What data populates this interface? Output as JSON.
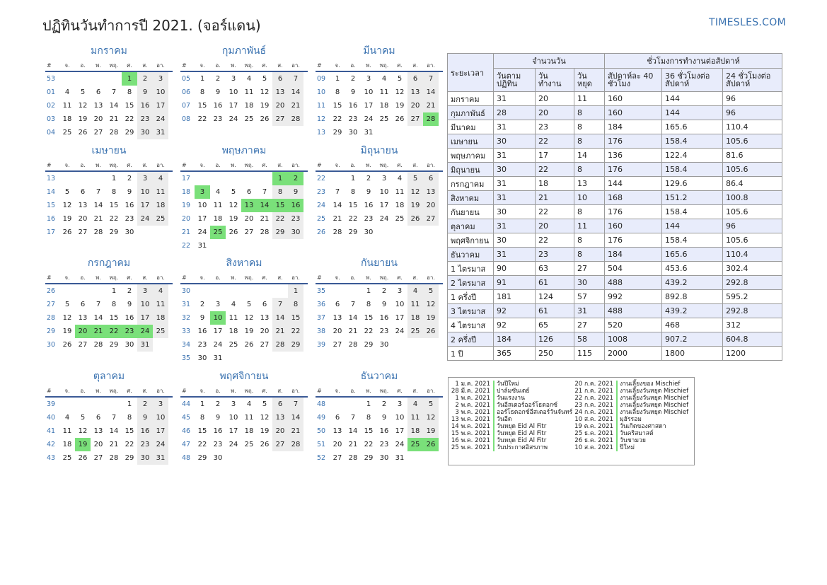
{
  "title": "ปฏิทินวันทำการปี 2021. (จอร์แดน)",
  "site": "TIMESLES.COM",
  "colors": {
    "accent": "#3a72b0",
    "holiday": "#7ae07a",
    "weekend": "#ececec",
    "table_header": "#e8ecfb"
  },
  "weekday_headers": [
    "#",
    "จ.",
    "อ.",
    "พ.",
    "พฤ.",
    "ศ.",
    "ส.",
    "อา."
  ],
  "months": [
    {
      "name": "มกราคม",
      "first": 4,
      "days": 31,
      "weeks": [
        "53",
        "01",
        "02",
        "03",
        "04"
      ],
      "holidays": [
        1
      ]
    },
    {
      "name": "กุมภาพันธ์",
      "first": 0,
      "days": 28,
      "weeks": [
        "05",
        "06",
        "07",
        "08"
      ],
      "holidays": []
    },
    {
      "name": "มีนาคม",
      "first": 0,
      "days": 31,
      "weeks": [
        "09",
        "10",
        "11",
        "12",
        "13"
      ],
      "holidays": [
        28
      ]
    },
    {
      "name": "เมษายน",
      "first": 3,
      "days": 30,
      "weeks": [
        "13",
        "14",
        "15",
        "16",
        "17"
      ],
      "holidays": []
    },
    {
      "name": "พฤษภาคม",
      "first": 5,
      "days": 31,
      "weeks": [
        "17",
        "18",
        "19",
        "20",
        "21",
        "22"
      ],
      "holidays": [
        1,
        2,
        3,
        13,
        14,
        15,
        16,
        25
      ]
    },
    {
      "name": "มิถุนายน",
      "first": 1,
      "days": 30,
      "weeks": [
        "22",
        "23",
        "24",
        "25",
        "26"
      ],
      "holidays": []
    },
    {
      "name": "กรกฎาคม",
      "first": 3,
      "days": 31,
      "weeks": [
        "26",
        "27",
        "28",
        "29",
        "30"
      ],
      "holidays": [
        20,
        21,
        22,
        23,
        24
      ]
    },
    {
      "name": "สิงหาคม",
      "first": 6,
      "days": 31,
      "weeks": [
        "30",
        "31",
        "32",
        "33",
        "34",
        "35"
      ],
      "holidays": [
        10
      ]
    },
    {
      "name": "กันยายน",
      "first": 2,
      "days": 30,
      "weeks": [
        "35",
        "36",
        "37",
        "38",
        "39"
      ],
      "holidays": []
    },
    {
      "name": "ตุลาคม",
      "first": 4,
      "days": 31,
      "weeks": [
        "39",
        "40",
        "41",
        "42",
        "43"
      ],
      "holidays": [
        19
      ]
    },
    {
      "name": "พฤศจิกายน",
      "first": 0,
      "days": 30,
      "weeks": [
        "44",
        "45",
        "46",
        "47",
        "48"
      ],
      "holidays": []
    },
    {
      "name": "ธันวาคม",
      "first": 2,
      "days": 31,
      "weeks": [
        "48",
        "49",
        "50",
        "51",
        "52"
      ],
      "holidays": [
        25,
        26
      ]
    }
  ],
  "stats": {
    "period_header": "ระยะเวลา",
    "days_group": "จำนวนวัน",
    "hours_group": "ชั่วโมงการทำงานต่อสัปดาห์",
    "col_calendar": "วันตามปฏิทิน",
    "col_work": "วันทำงาน",
    "col_off": "วันหยุด",
    "col_40": "สัปดาห์ละ 40 ชั่วโมง",
    "col_36": "36 ชั่วโมงต่อสัปดาห์",
    "col_24": "24 ชั่วโมงต่อสัปดาห์",
    "rows": [
      [
        "มกราคม",
        "31",
        "20",
        "11",
        "160",
        "144",
        "96"
      ],
      [
        "กุมภาพันธ์",
        "28",
        "20",
        "8",
        "160",
        "144",
        "96"
      ],
      [
        "มีนาคม",
        "31",
        "23",
        "8",
        "184",
        "165.6",
        "110.4"
      ],
      [
        "เมษายน",
        "30",
        "22",
        "8",
        "176",
        "158.4",
        "105.6"
      ],
      [
        "พฤษภาคม",
        "31",
        "17",
        "14",
        "136",
        "122.4",
        "81.6"
      ],
      [
        "มิถุนายน",
        "30",
        "22",
        "8",
        "176",
        "158.4",
        "105.6"
      ],
      [
        "กรกฎาคม",
        "31",
        "18",
        "13",
        "144",
        "129.6",
        "86.4"
      ],
      [
        "สิงหาคม",
        "31",
        "21",
        "10",
        "168",
        "151.2",
        "100.8"
      ],
      [
        "กันยายน",
        "30",
        "22",
        "8",
        "176",
        "158.4",
        "105.6"
      ],
      [
        "ตุลาคม",
        "31",
        "20",
        "11",
        "160",
        "144",
        "96"
      ],
      [
        "พฤศจิกายน",
        "30",
        "22",
        "8",
        "176",
        "158.4",
        "105.6"
      ],
      [
        "ธันวาคม",
        "31",
        "23",
        "8",
        "184",
        "165.6",
        "110.4"
      ],
      [
        "1 ไตรมาส",
        "90",
        "63",
        "27",
        "504",
        "453.6",
        "302.4"
      ],
      [
        "2 ไตรมาส",
        "91",
        "61",
        "30",
        "488",
        "439.2",
        "292.8"
      ],
      [
        "1 ครึ่งปี",
        "181",
        "124",
        "57",
        "992",
        "892.8",
        "595.2"
      ],
      [
        "3 ไตรมาส",
        "92",
        "61",
        "31",
        "488",
        "439.2",
        "292.8"
      ],
      [
        "4 ไตรมาส",
        "92",
        "65",
        "27",
        "520",
        "468",
        "312"
      ],
      [
        "2 ครึ่งปี",
        "184",
        "126",
        "58",
        "1008",
        "907.2",
        "604.8"
      ],
      [
        "1 ปี",
        "365",
        "250",
        "115",
        "2000",
        "1800",
        "1200"
      ]
    ]
  },
  "holiday_list": {
    "left": [
      [
        "1 ม.ค. 2021",
        "วันปีใหม่"
      ],
      [
        "28 มี.ค. 2021",
        "ปาล์มซันเดย์"
      ],
      [
        "1 พ.ค. 2021",
        "วันแรงงาน"
      ],
      [
        "2 พ.ค. 2021",
        "วันอีสเตอร์ออร์โธดอกซ์"
      ],
      [
        "3 พ.ค. 2021",
        "ออร์โธดอกซ์อีสเตอร์วันจันทร์"
      ],
      [
        "13 พ.ค. 2021",
        "วันอีด"
      ],
      [
        "14 พ.ค. 2021",
        "วันหยุด Eid Al Fitr"
      ],
      [
        "15 พ.ค. 2021",
        "วันหยุด Eid Al Fitr"
      ],
      [
        "16 พ.ค. 2021",
        "วันหยุด Eid Al Fitr"
      ],
      [
        "25 พ.ค. 2021",
        "วันประกาศอิสรภาพ"
      ]
    ],
    "right": [
      [
        "20 ก.ค. 2021",
        "งานเลี้ยงของ Mischief"
      ],
      [
        "21 ก.ค. 2021",
        "งานเลี้ยงวันหยุด Mischief"
      ],
      [
        "22 ก.ค. 2021",
        "งานเลี้ยงวันหยุด Mischief"
      ],
      [
        "23 ก.ค. 2021",
        "งานเลี้ยงวันหยุด Mischief"
      ],
      [
        "24 ก.ค. 2021",
        "งานเลี้ยงวันหยุด Mischief"
      ],
      [
        "10 ส.ค. 2021",
        "มุฮัรรอม"
      ],
      [
        "19 ต.ค. 2021",
        "วันเกิดของศาสดา"
      ],
      [
        "25 ธ.ค. 2021",
        "วันคริสมาสต์"
      ],
      [
        "26 ธ.ค. 2021",
        "วันชามวย"
      ],
      [
        "10 ส.ค. 2021",
        "ปีใหม่"
      ]
    ]
  }
}
